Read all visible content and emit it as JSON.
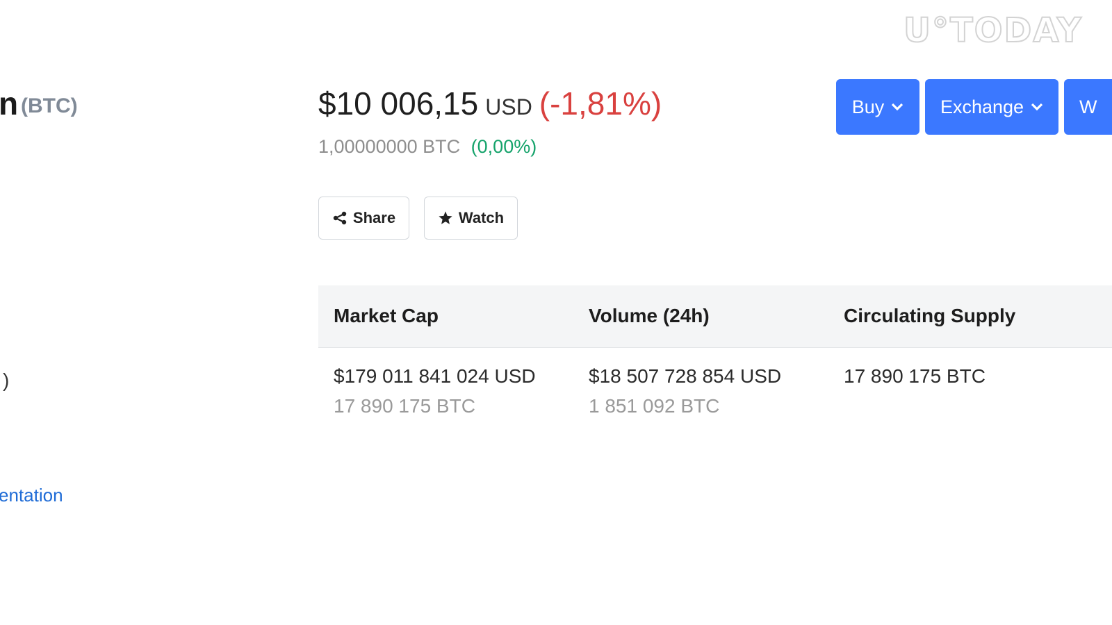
{
  "watermark": "U°TODAY",
  "coin": {
    "name_fragment": "n",
    "symbol": "(BTC)",
    "paren_fragment": ")",
    "link_fragment": "entation"
  },
  "price": {
    "value": "$10 006,15",
    "currency": "USD",
    "change": "(-1,81%)",
    "btc_value": "1,00000000 BTC",
    "btc_change": "(0,00%)",
    "colors": {
      "negative": "#d9413f",
      "positive": "#15a36b"
    }
  },
  "actions": {
    "share_label": "Share",
    "watch_label": "Watch",
    "buy_label": "Buy",
    "exchange_label": "Exchange",
    "wallet_label": "W",
    "accent": "#3b78ff"
  },
  "stats": {
    "headers": [
      "Market Cap",
      "Volume (24h)",
      "Circulating Supply"
    ],
    "market_cap": {
      "usd": "$179 011 841 024 USD",
      "btc": "17 890 175 BTC"
    },
    "volume": {
      "usd": "$18 507 728 854 USD",
      "btc": "1 851 092 BTC"
    },
    "supply": {
      "btc": "17 890 175 BTC"
    }
  }
}
